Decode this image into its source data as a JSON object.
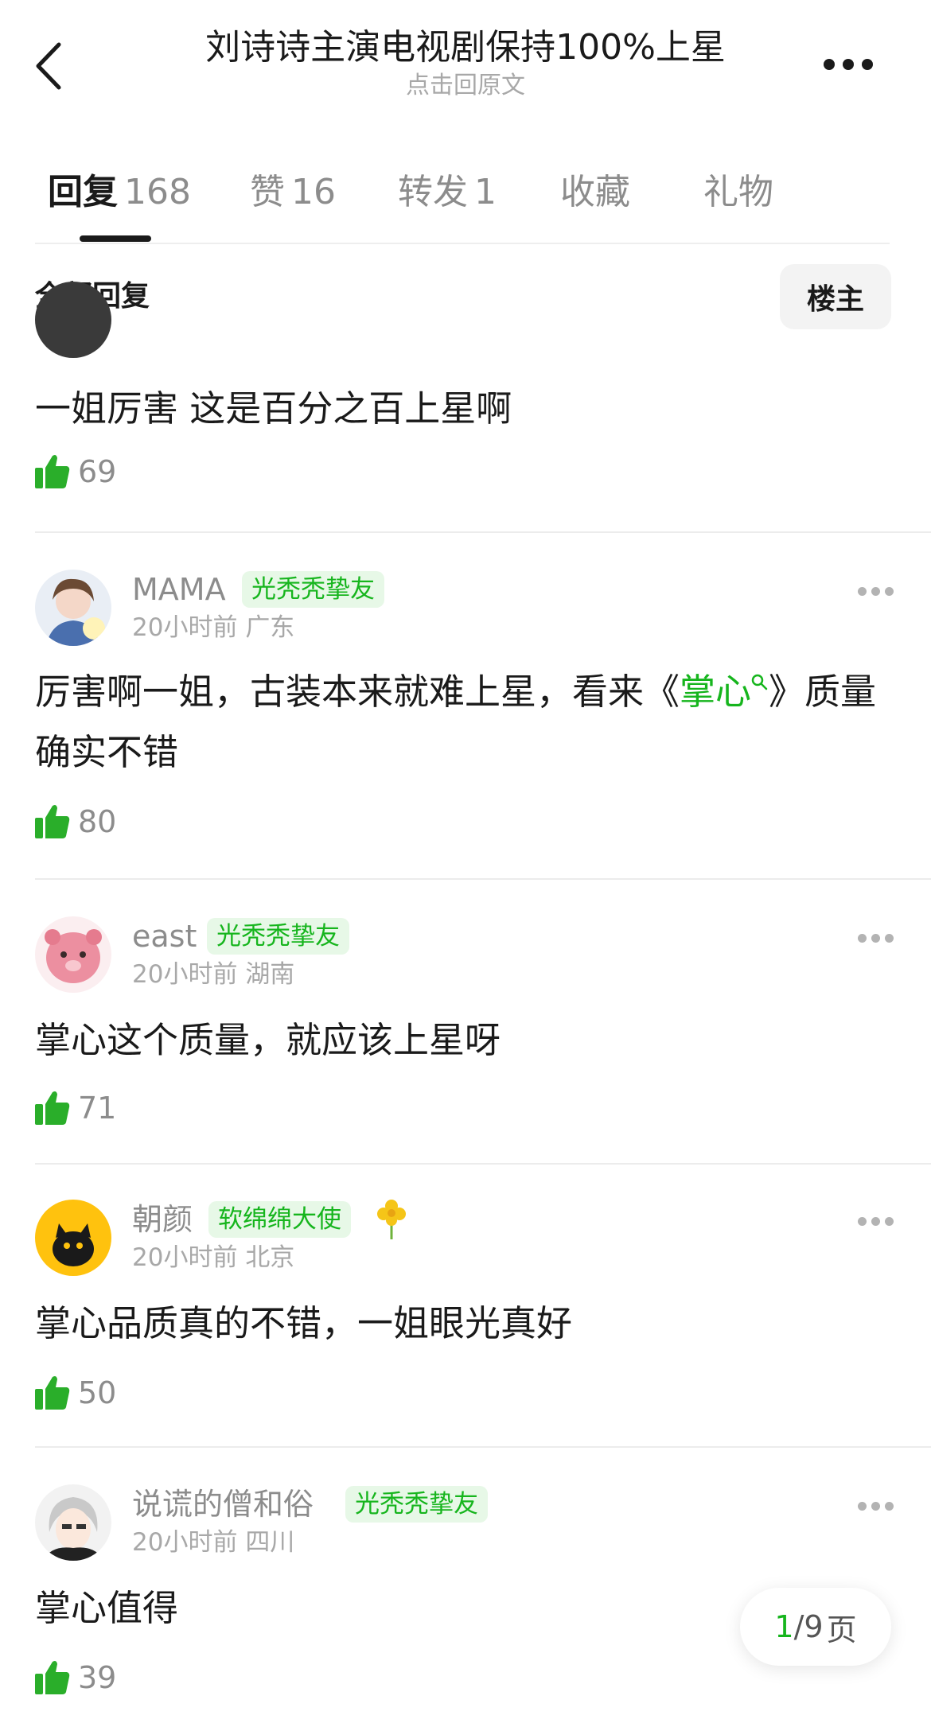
{
  "header": {
    "title": "刘诗诗主演电视剧保持100%上星",
    "subtitle": "点击回原文"
  },
  "tabs": [
    {
      "label": "回复",
      "count": "168"
    },
    {
      "label": "赞",
      "count": "16"
    },
    {
      "label": "转发",
      "count": "1"
    },
    {
      "label": "收藏",
      "count": ""
    },
    {
      "label": "礼物",
      "count": ""
    }
  ],
  "filter": {
    "all_replies": "全部回复",
    "op_only": "楼主"
  },
  "comments": [
    {
      "text": "一姐厉害 这是百分之百上星啊",
      "likes": "69"
    },
    {
      "name": "MAMA",
      "badge": "光秃秃挚友",
      "time": "20小时前",
      "location": "广东",
      "text_before": "厉害啊一姐，古装本来就难上星，看来《",
      "link": "掌心",
      "text_after": "》质量确实不错",
      "likes": "80"
    },
    {
      "name": "east",
      "badge": "光秃秃挚友",
      "time": "20小时前",
      "location": "湖南",
      "text": "掌心这个质量，就应该上星呀",
      "likes": "71"
    },
    {
      "name": "朝颜",
      "badge": "软绵绵大使",
      "time": "20小时前",
      "location": "北京",
      "text": "掌心品质真的不错，一姐眼光真好",
      "likes": "50"
    },
    {
      "name": "说谎的僧和俗",
      "badge": "光秃秃挚友",
      "time": "20小时前",
      "location": "四川",
      "text": "掌心值得",
      "likes": "39"
    }
  ],
  "pager": {
    "current": "1",
    "total": "/9",
    "unit": "页"
  },
  "colors": {
    "accent_green": "#16b51d",
    "badge_bg": "#e7f8e7",
    "like_green": "#2aae2a"
  },
  "icons": {
    "back": "chevron-left-icon",
    "more": "more-dots-icon",
    "like": "thumbs-up-icon",
    "search": "search-icon",
    "flower": "flower-icon"
  }
}
